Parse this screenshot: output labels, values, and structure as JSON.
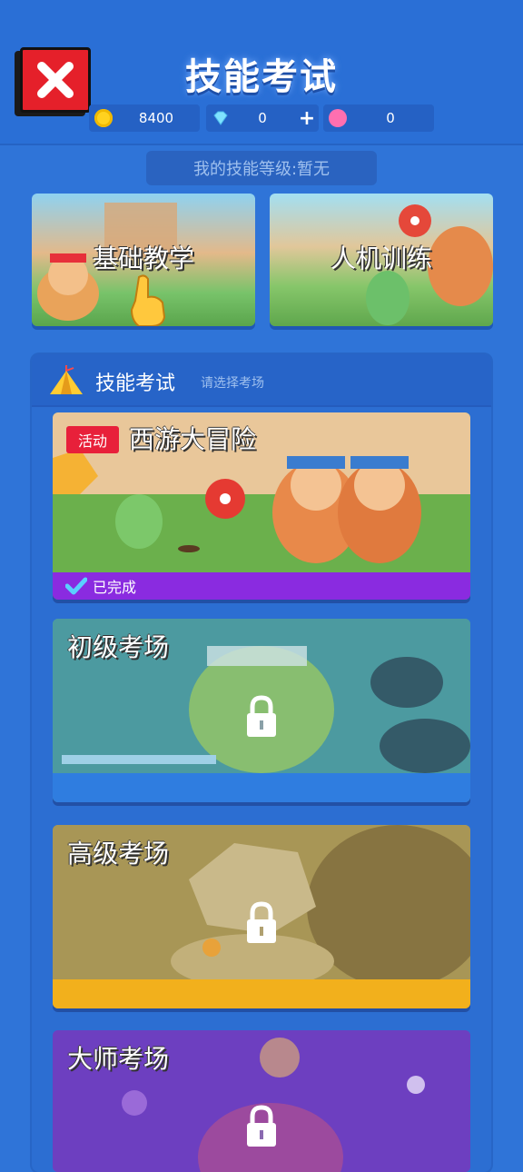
{
  "header": {
    "title": "技能考试"
  },
  "currencies": [
    {
      "icon": "coin-icon",
      "value": "8400",
      "color": "#ffd21f"
    },
    {
      "icon": "diamond-icon",
      "value": "0",
      "color": "#7fe3ff",
      "plus": "+"
    },
    {
      "icon": "lotus-icon",
      "value": "0",
      "color": "#ff6fb0"
    }
  ],
  "skill_level": "我的技能等级:暂无",
  "modes": [
    {
      "label": "基础教学"
    },
    {
      "label": "人机训练"
    }
  ],
  "exam_panel": {
    "title": "技能考试",
    "subtitle": "请选择考场",
    "cards": [
      {
        "title": "西游大冒险",
        "badge": "活动",
        "status": "已完成"
      },
      {
        "title": "初级考场"
      },
      {
        "title": "高级考场"
      },
      {
        "title": "大师考场"
      }
    ]
  },
  "colors": {
    "background": "#2f74d8",
    "close_button": "#e5202a",
    "event_badge": "#e8203a",
    "completed_bar": "#8a2be0",
    "beginner_bar": "#2f7de0",
    "advanced_bar": "#f2b01c"
  }
}
